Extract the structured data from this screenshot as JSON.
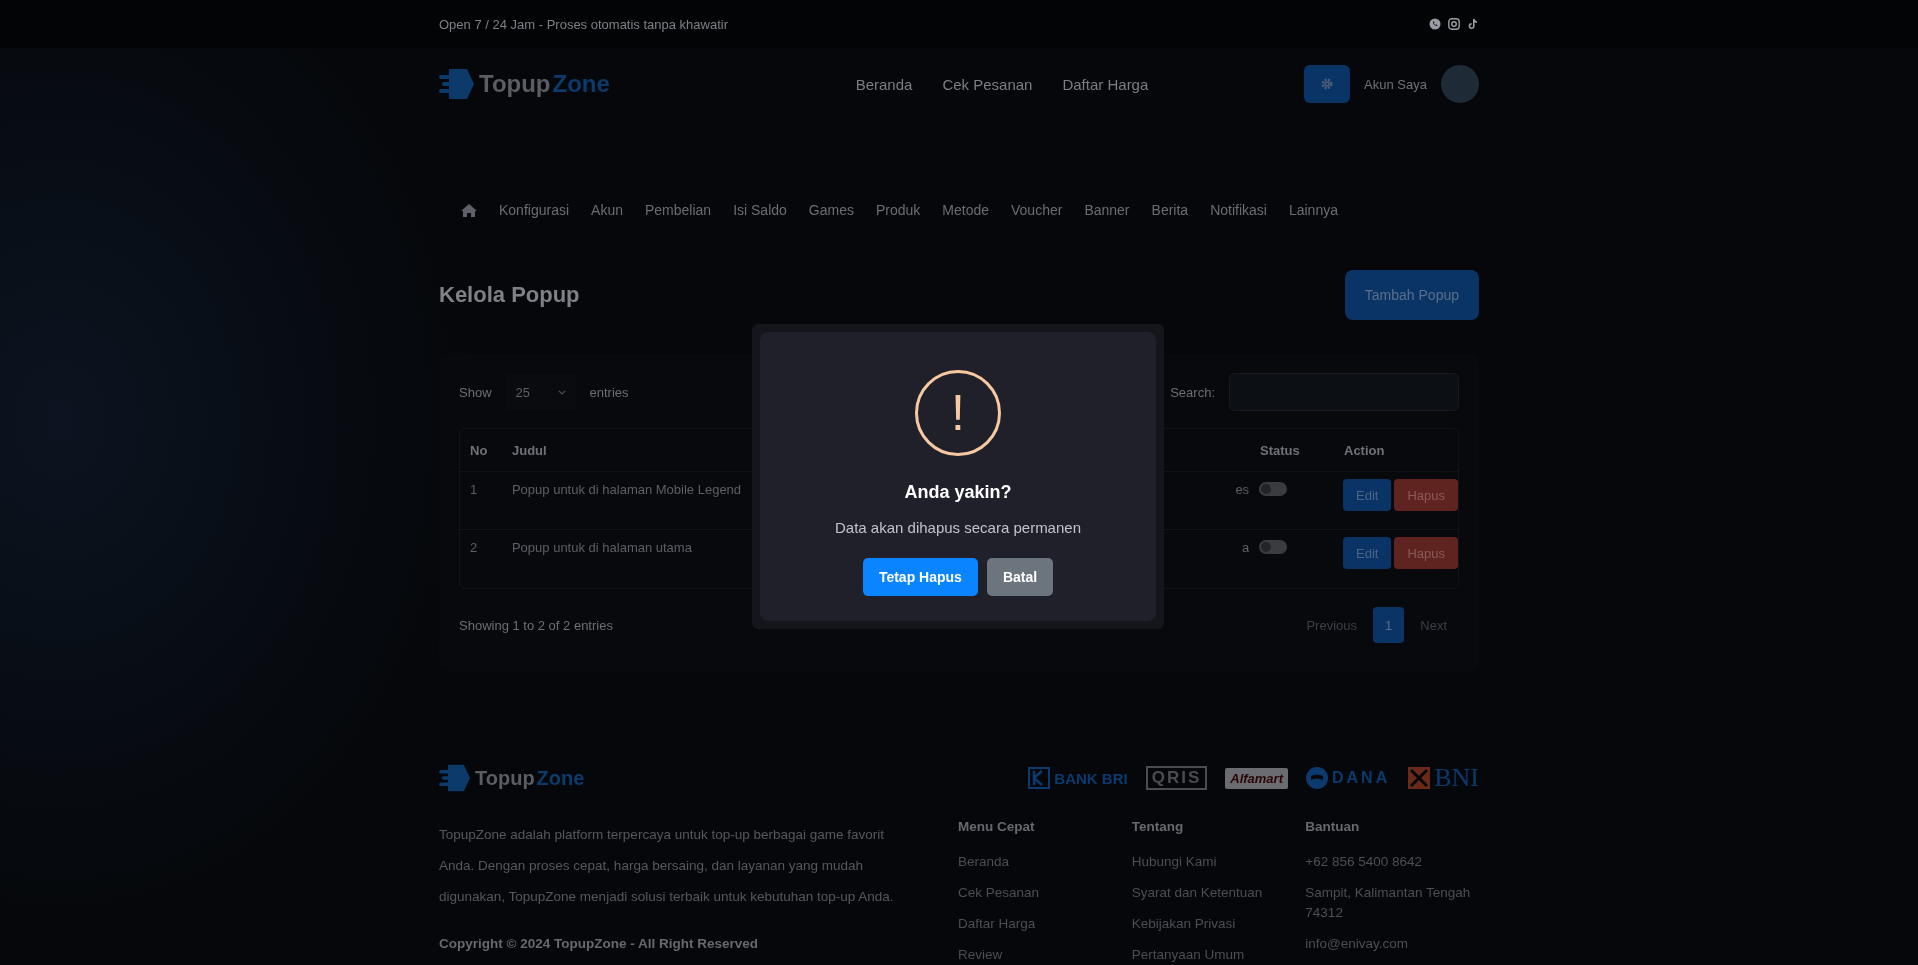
{
  "top_bar": {
    "text": "Open 7 / 24 Jam - Proses otomatis tanpa khawatir"
  },
  "header": {
    "logo": {
      "part_1": "Topup",
      "part_2": "Zone"
    },
    "nav": [
      "Beranda",
      "Cek Pesanan",
      "Daftar Harga"
    ],
    "account_label": "Akun Saya"
  },
  "admin_menu": [
    "Konfigurasi",
    "Akun",
    "Pembelian",
    "Isi Saldo",
    "Games",
    "Produk",
    "Metode",
    "Voucher",
    "Banner",
    "Berita",
    "Notifikasi",
    "Lainnya"
  ],
  "page": {
    "title": "Kelola Popup",
    "add_button": "Tambah Popup"
  },
  "table_controls": {
    "show_label": "Show",
    "page_size": "25",
    "entries_label": "entries",
    "search_label": "Search:"
  },
  "table": {
    "columns": [
      "No",
      "Judul",
      "Status",
      "Action"
    ],
    "rows": [
      {
        "no": "1",
        "title": "Popup untuk di halaman Mobile Legend",
        "column_3": "es",
        "on": false,
        "actions": [
          "Edit",
          "Hapus"
        ]
      },
      {
        "no": "2",
        "title": "Popup untuk di halaman utama",
        "column_3": "a",
        "on": false,
        "actions": [
          "Edit",
          "Hapus"
        ]
      }
    ]
  },
  "table_info": "Showing 1 to 2 of 2 entries",
  "pagination": [
    {
      "label": "Previous",
      "selected": false
    },
    {
      "label": "1",
      "selected": true
    },
    {
      "label": "Next",
      "selected": false
    }
  ],
  "modal": {
    "icon": "!",
    "title": "Anda yakin?",
    "message": "Data akan dihapus secara permanen",
    "confirm": "Tetap Hapus",
    "cancel": "Batal"
  },
  "footer": {
    "logo": {
      "part_1": "Topup",
      "part_2": "Zone"
    },
    "payments": [
      {
        "kind": "bri",
        "label": "BANK BRI"
      },
      {
        "kind": "qris",
        "label": "QRIS"
      },
      {
        "kind": "alfamart",
        "label": "Alfamart"
      },
      {
        "kind": "dana",
        "label": "DANA"
      },
      {
        "kind": "bni",
        "label": "BNI"
      }
    ],
    "description": "TopupZone adalah platform terpercaya untuk top-up berbagai game favorit Anda. Dengan proses cepat, harga bersaing, dan layanan yang mudah digunakan, TopupZone menjadi solusi terbaik untuk kebutuhan top-up Anda.",
    "copyright": "Copyright © 2024 TopupZone - All Right Reserved",
    "columns": [
      {
        "heading": "Menu Cepat",
        "links": [
          "Beranda",
          "Cek Pesanan",
          "Daftar Harga",
          "Review"
        ]
      },
      {
        "heading": "Tentang",
        "links": [
          "Hubungi Kami",
          "Syarat dan Ketentuan",
          "Kebijakan Privasi",
          "Pertanyaan Umum"
        ]
      },
      {
        "heading": "Bantuan",
        "links": [
          "+62 856 5400 8642",
          "Sampit, Kalimantan Tengah 74312",
          "info@enivay.com"
        ]
      }
    ]
  }
}
